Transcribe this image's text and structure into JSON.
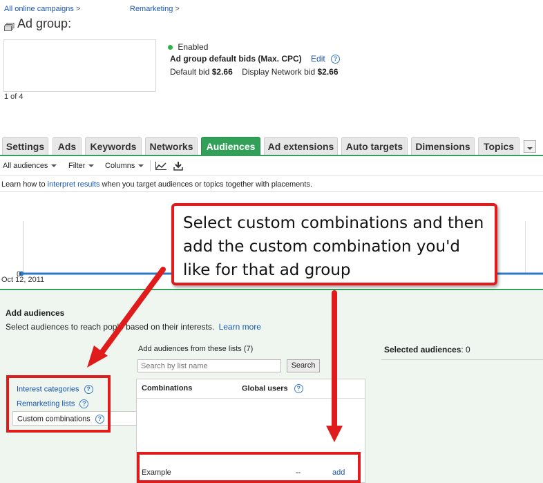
{
  "breadcrumb": {
    "campaigns": "All online campaigns",
    "remarketing": "Remarketing",
    "sep": ">"
  },
  "page_title": "Ad group:",
  "preview": {
    "pager": "1 of 4"
  },
  "status": {
    "label": "Enabled",
    "color": "#2db34a"
  },
  "bids": {
    "heading": "Ad group default bids (Max. CPC)",
    "edit": "Edit",
    "default_label": "Default bid",
    "default_value": "$2.66",
    "display_label": "Display Network bid",
    "display_value": "$2.66"
  },
  "tabs": [
    {
      "label": "Settings",
      "active": false
    },
    {
      "label": "Ads",
      "active": false
    },
    {
      "label": "Keywords",
      "active": false
    },
    {
      "label": "Networks",
      "active": false
    },
    {
      "label": "Audiences",
      "active": true
    },
    {
      "label": "Ad extensions",
      "active": false
    },
    {
      "label": "Auto targets",
      "active": false
    },
    {
      "label": "Dimensions",
      "active": false
    },
    {
      "label": "Topics",
      "active": false
    }
  ],
  "toolbar": {
    "all_audiences": "All audiences",
    "filter": "Filter",
    "columns": "Columns"
  },
  "info": {
    "before": "Learn how to ",
    "link": "interpret results",
    "after": " when you target audiences or topics together with placements."
  },
  "chart_data": {
    "type": "line",
    "y_tick": "0",
    "x_tick": "Oct 12, 2011",
    "values": [
      0
    ]
  },
  "callout": {
    "text": "Select custom combinations and then add the custom combination you'd like for that ad group"
  },
  "add_audiences": {
    "heading": "Add audiences",
    "desc_before": "Select audiences to reach p",
    "desc_after": "ople based on their interests.",
    "learn_more": "Learn more",
    "lists_label": "Add audiences from these lists (7)",
    "search_placeholder": "Search by list name",
    "search_button": "Search",
    "selected_label": "Selected audiences",
    "selected_count": ": 0",
    "categories": [
      "Interest categories",
      "Remarketing lists",
      "Custom combinations"
    ],
    "col_combinations": "Combinations",
    "col_global": "Global users",
    "row": {
      "name": "Example",
      "users": "--",
      "action": "add"
    }
  },
  "help_glyph": "?"
}
